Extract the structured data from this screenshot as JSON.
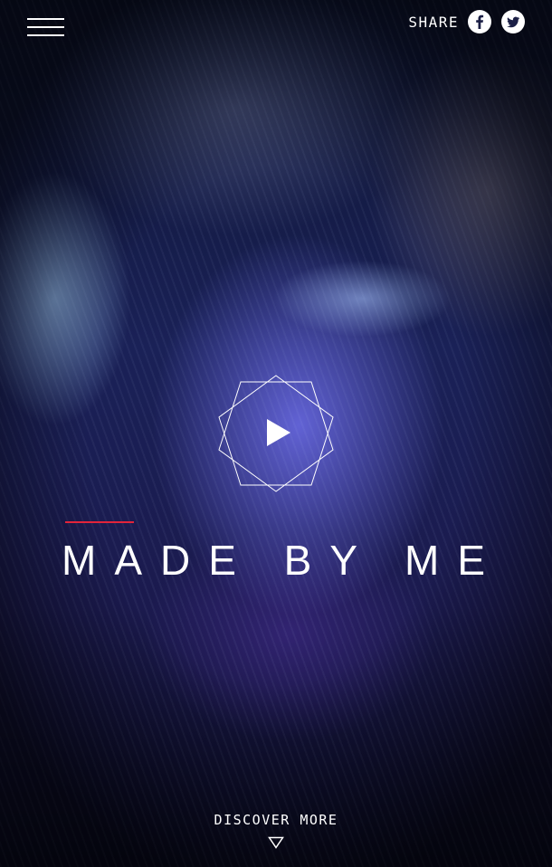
{
  "header": {
    "menu_icon": "hamburger-menu-icon",
    "share_label": "SHARE",
    "share_icons": [
      "facebook-icon",
      "twitter-icon"
    ]
  },
  "hero": {
    "play_icon": "play-icon",
    "title": "MADE BY ME",
    "accent_color": "#e2243a"
  },
  "footer": {
    "discover_label": "DISCOVER MORE",
    "arrow_icon": "triangle-down-icon"
  }
}
